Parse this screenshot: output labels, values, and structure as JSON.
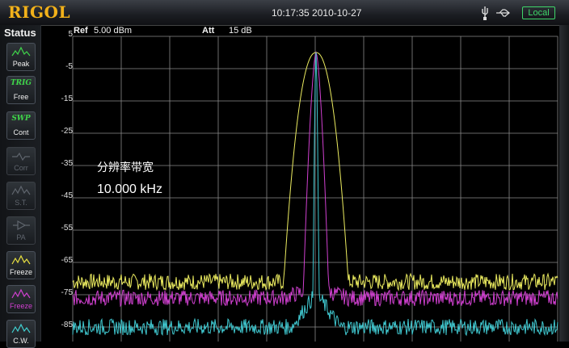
{
  "header": {
    "brand": "RIGOL",
    "datetime": "10:17:35 2010-10-27",
    "remote_status": "Local"
  },
  "status_panel": {
    "title": "Status",
    "buttons": [
      {
        "icon": "peak-icon",
        "label": "Peak",
        "enabled": true
      },
      {
        "icon_text": "TRIG",
        "label": "Free",
        "enabled": true
      },
      {
        "icon_text": "SWP",
        "label": "Cont",
        "enabled": true
      },
      {
        "icon": "corr-icon",
        "label": "Corr",
        "enabled": false
      },
      {
        "icon": "st-icon",
        "label": "S.T.",
        "enabled": false
      },
      {
        "icon": "pa-icon",
        "label": "PA",
        "enabled": false
      },
      {
        "icon": "freeze-icon",
        "label": "Freeze",
        "enabled": true,
        "color": "#e8e040"
      },
      {
        "icon": "freeze-icon",
        "label": "Freeze",
        "enabled": true,
        "color": "#d040d0"
      },
      {
        "icon": "cw-icon",
        "label": "C.W.",
        "enabled": true,
        "color": "#40d0d0"
      }
    ]
  },
  "measurement": {
    "ref_label": "Ref",
    "ref_value": "5.00 dBm",
    "att_label": "Att",
    "att_value": "15 dB"
  },
  "annotation": {
    "title": "分辨率带宽",
    "value": "10.000 kHz"
  },
  "y_ticks": [
    "5",
    "-5",
    "-15",
    "-25",
    "-35",
    "-45",
    "-55",
    "-65",
    "-75",
    "-85"
  ],
  "colors": {
    "trace_1": "#ecec60",
    "trace_2": "#d040d0",
    "trace_3": "#40c8d0",
    "grid": "#8a8a8a",
    "brand": "#f2b11a",
    "local_badge": "#3fd66a"
  },
  "chart_data": {
    "type": "line",
    "ylim": [
      -90,
      5
    ],
    "y_unit": "dBm",
    "series": [
      {
        "color": "#ecec60",
        "noise_floor_dbm": -71,
        "peak_dbm": 0,
        "shape": "wide"
      },
      {
        "color": "#d040d0",
        "noise_floor_dbm": -76,
        "peak_dbm": 0,
        "shape": "medium"
      },
      {
        "color": "#40c8d0",
        "noise_floor_dbm": -85,
        "peak_dbm": 0,
        "shape": "narrow"
      }
    ],
    "grid": true
  }
}
